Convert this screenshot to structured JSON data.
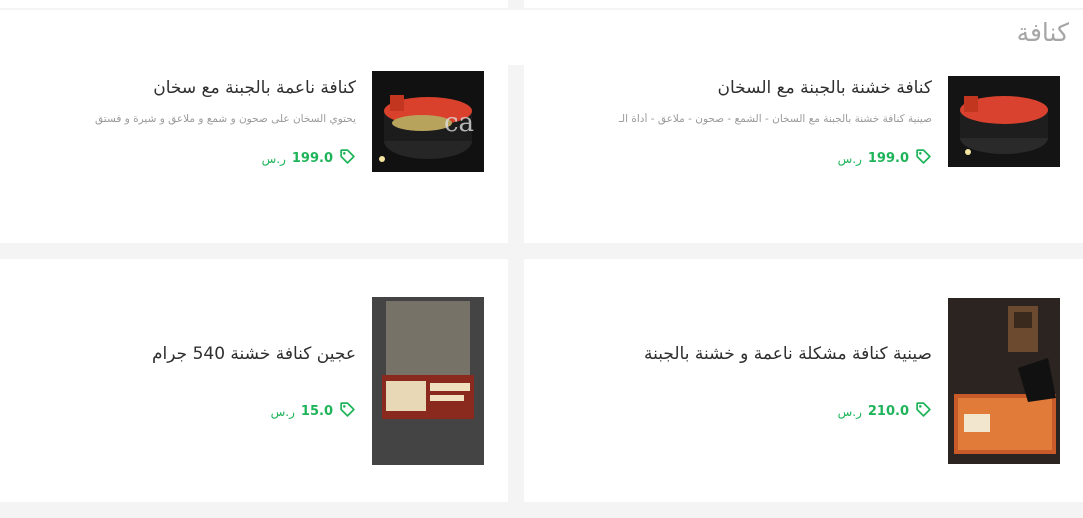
{
  "section": {
    "title": "كنافة"
  },
  "colors": {
    "price": "#1fb45a",
    "title_text": "#2f2f2f",
    "muted": "#9a9a9a",
    "section_title": "#a6a6a6"
  },
  "products": [
    {
      "name": "كنافة خشنة بالجبنة مع السخان",
      "description": "صينية كنافة خشنة بالجبنة مع السخان - الشمع - صحون - ملاعق - أداة الـ",
      "price": "199.0",
      "currency": "ر.س",
      "icon": "price-tag-icon"
    },
    {
      "name": "كنافة ناعمة بالجبنة مع سخان",
      "description": "يحتوي السخان على صحون و شمع و ملاعق و شيرة و فستق",
      "price": "199.0",
      "currency": "ر.س",
      "icon": "price-tag-icon"
    },
    {
      "name": "صينية كنافة مشكلة ناعمة و خشنة بالجبنة",
      "description": "",
      "price": "210.0",
      "currency": "ر.س",
      "icon": "price-tag-icon"
    },
    {
      "name": "عجين كنافة خشنة 540 جرام",
      "description": "",
      "price": "15.0",
      "currency": "ر.س",
      "icon": "price-tag-icon"
    }
  ]
}
